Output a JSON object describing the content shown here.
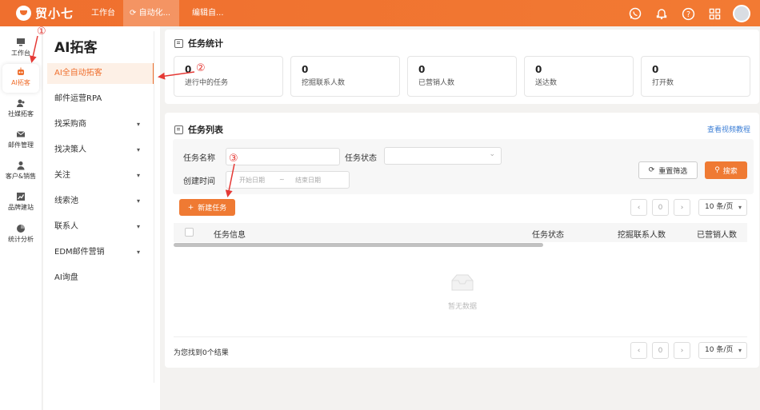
{
  "app": {
    "name": "贸小七"
  },
  "topbar": {
    "tabs": [
      {
        "label": "工作台"
      },
      {
        "label": "自动化..."
      },
      {
        "label": "编辑自..."
      }
    ],
    "icons": [
      "whatsapp-icon",
      "bell-icon",
      "help-icon",
      "grid-icon",
      "avatar"
    ]
  },
  "rail": {
    "items": [
      {
        "label": "工作台",
        "icon": "monitor-icon"
      },
      {
        "label": "AI拓客",
        "icon": "robot-icon"
      },
      {
        "label": "社媒拓客",
        "icon": "people-icon"
      },
      {
        "label": "邮件管理",
        "icon": "mail-icon"
      },
      {
        "label": "客户&销售",
        "icon": "customer-icon"
      },
      {
        "label": "品牌建站",
        "icon": "chart-line-icon"
      },
      {
        "label": "统计分析",
        "icon": "pie-icon"
      }
    ]
  },
  "sidebar": {
    "title": "AI拓客",
    "items": [
      {
        "label": "AI全自动拓客"
      },
      {
        "label": "邮件运营RPA"
      },
      {
        "label": "找采购商"
      },
      {
        "label": "找决策人"
      },
      {
        "label": "关注"
      },
      {
        "label": "线索池"
      },
      {
        "label": "联系人"
      },
      {
        "label": "EDM邮件营销"
      },
      {
        "label": "AI询盘"
      }
    ]
  },
  "stats": {
    "title": "任务统计",
    "items": [
      {
        "value": "0",
        "label": "进行中的任务"
      },
      {
        "value": "0",
        "label": "挖掘联系人数"
      },
      {
        "value": "0",
        "label": "已营销人数"
      },
      {
        "value": "0",
        "label": "送达数"
      },
      {
        "value": "0",
        "label": "打开数"
      }
    ]
  },
  "tasks": {
    "title": "任务列表",
    "tutorial_link": "查看视频教程",
    "filters": {
      "name_label": "任务名称",
      "status_label": "任务状态",
      "time_label": "创建时间",
      "start_placeholder": "开始日期",
      "range_sep": "~",
      "end_placeholder": "结束日期"
    },
    "reset_label": "重置筛选",
    "search_label": "搜索",
    "new_label": "新建任务",
    "page": "0",
    "page_size": "10 条/页",
    "columns": [
      "任务信息",
      "任务状态",
      "挖掘联系人数",
      "已营销人数"
    ],
    "empty_text": "暂无数据",
    "result_text": "为您找到0个结果"
  },
  "annotations": [
    "①",
    "②",
    "③"
  ],
  "colors": {
    "accent": "#ef7a33",
    "annotation": "#e53935",
    "link": "#3d7fd6"
  }
}
